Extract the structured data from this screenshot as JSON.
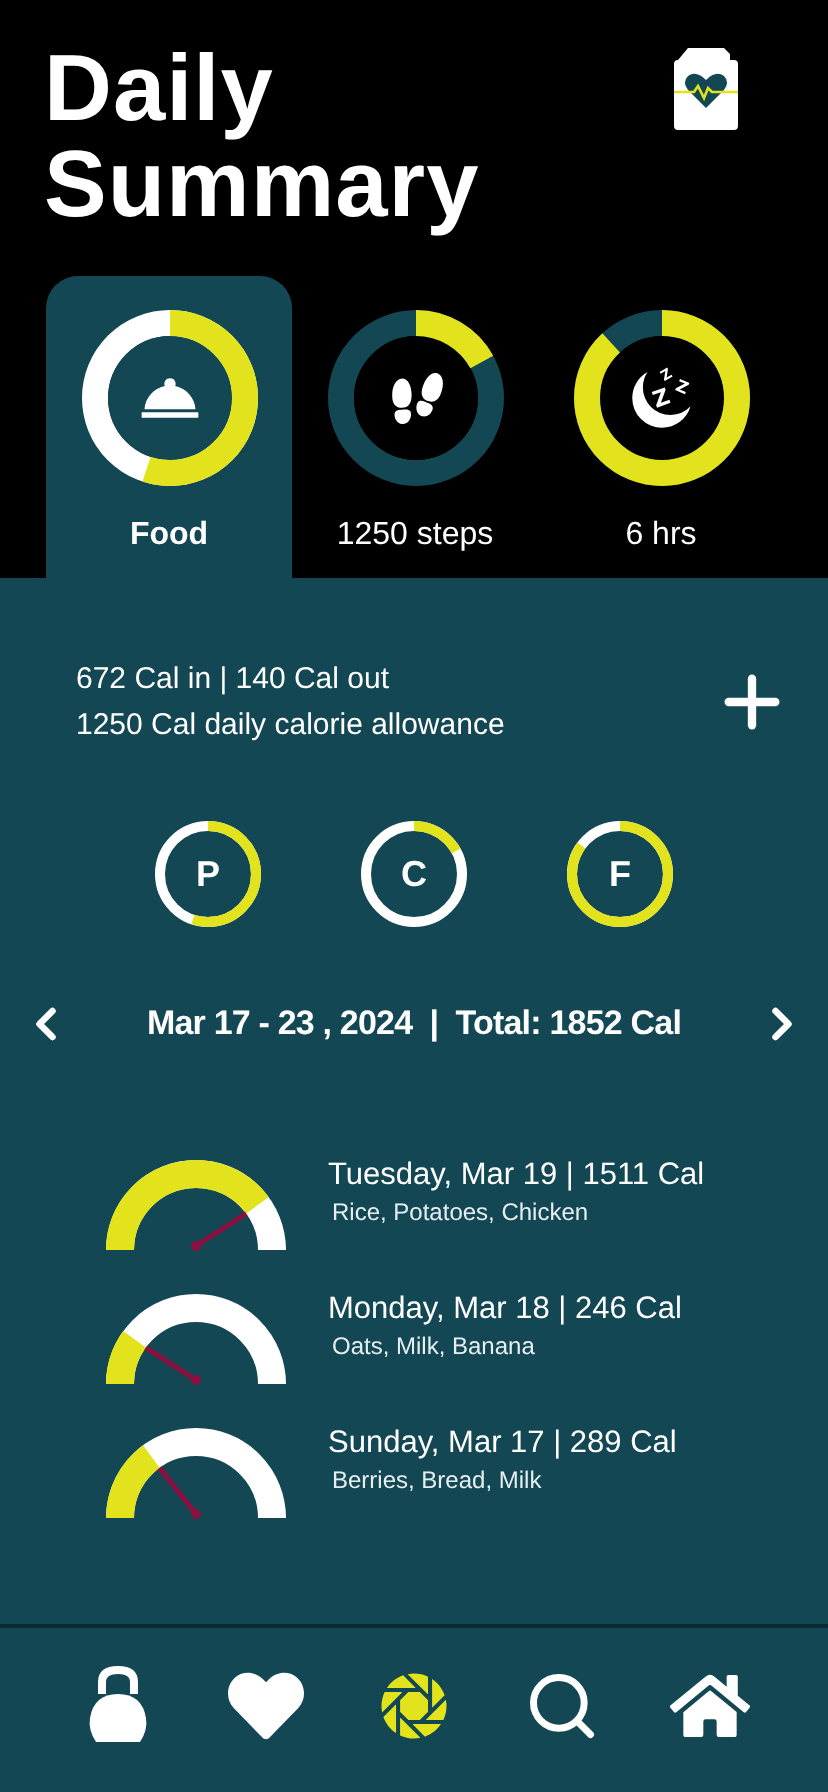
{
  "header": {
    "title": "Daily Summary"
  },
  "tabs": [
    {
      "kind": "food",
      "label": "Food",
      "selected": true
    },
    {
      "kind": "steps",
      "label": "1250 steps",
      "selected": false
    },
    {
      "kind": "sleep",
      "label": "6 hrs",
      "selected": false
    }
  ],
  "summary": {
    "lines": [
      "672 Cal in | 140 Cal out",
      "1250 Cal daily calorie allowance"
    ]
  },
  "macros": [
    {
      "label": "P"
    },
    {
      "label": "C"
    },
    {
      "label": "F"
    }
  ],
  "week": {
    "label": "Mar 17 - 23 , 2024  |  Total: 1852 Cal"
  },
  "days": [
    {
      "title": "Tuesday, Mar 19 | 1511 Cal",
      "foods": "Rice, Potatoes, Chicken"
    },
    {
      "title": "Monday, Mar 18 | 246 Cal",
      "foods": "Oats, Milk, Banana"
    },
    {
      "title": "Sunday, Mar 17 | 289 Cal",
      "foods": "Berries, Bread, Milk"
    }
  ],
  "nav": [
    {
      "kind": "kettlebell",
      "selected": false
    },
    {
      "kind": "heart",
      "selected": false
    },
    {
      "kind": "aperture",
      "selected": true
    },
    {
      "kind": "search",
      "selected": false
    },
    {
      "kind": "home",
      "selected": false
    }
  ]
}
